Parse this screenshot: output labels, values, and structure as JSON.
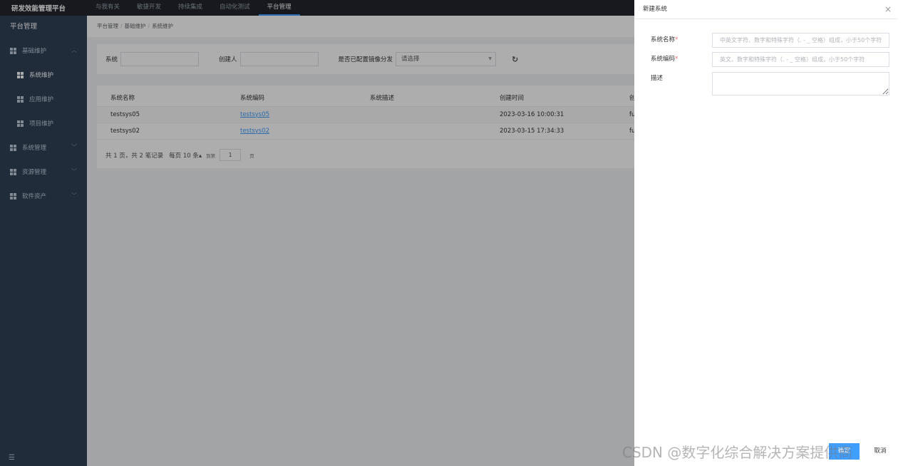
{
  "app": {
    "brand": "研发效能管理平台"
  },
  "topnav": [
    "与我有关",
    "敏捷开发",
    "持续集成",
    "自动化测试",
    "平台管理"
  ],
  "topnav_active": "平台管理",
  "sidebar": {
    "title": "平台管理",
    "items": [
      {
        "label": "基础维护",
        "expanded": true
      },
      {
        "label": "系统维护",
        "active": true
      },
      {
        "label": "应用维护"
      },
      {
        "label": "项目维护"
      },
      {
        "label": "系统管理"
      },
      {
        "label": "资源管理"
      },
      {
        "label": "软件资产"
      }
    ]
  },
  "breadcrumb": [
    "平台管理",
    "基础维护",
    "系统维护"
  ],
  "filter": {
    "system_label": "系统",
    "creator_label": "创建人",
    "mirror_label": "是否已配置镜像分发",
    "mirror_placeholder": "请选择"
  },
  "table": {
    "headers": [
      "系统名称",
      "系统编码",
      "系统描述",
      "创建时间",
      "创"
    ],
    "rows": [
      [
        "testsys05",
        "testsys05",
        "",
        "2023-03-16 10:00:31",
        "fu"
      ],
      [
        "testsys02",
        "testsys02",
        "",
        "2023-03-15 17:34:33",
        "fu"
      ]
    ]
  },
  "pager": {
    "summary": "共 1 页，共 2 笔记录",
    "per_page": "每页 10 条",
    "goto": "到第",
    "page": "1",
    "unit": "页"
  },
  "drawer": {
    "title": "新建系统",
    "fields": [
      {
        "label": "系统名称",
        "required": "*",
        "placeholder": "中英文字符、数字和特殊字符（. - _ 空格）组成，小于50个字符"
      },
      {
        "label": "系统编码",
        "required": "*",
        "placeholder": "英文、数字和特殊字符（. - _ 空格）组成，小于50个字符"
      },
      {
        "label": "描述",
        "required": "",
        "placeholder": ""
      }
    ],
    "confirm_label": "确定",
    "cancel_label": "取消"
  },
  "watermark": "CSDN @数字化综合解决方案提供商",
  "colors": {
    "accent": "#409eff",
    "sidebar": "#304156",
    "topbar": "#22262e"
  }
}
